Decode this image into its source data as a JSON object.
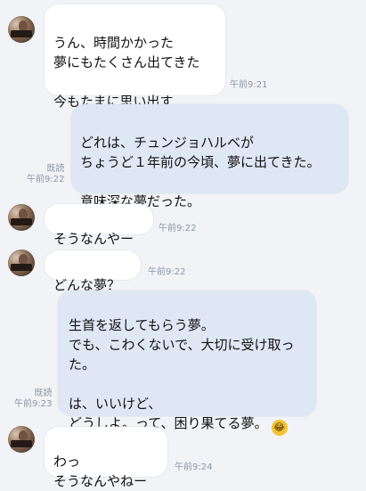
{
  "messages": [
    {
      "id": "m1",
      "direction": "incoming",
      "text": "うん、時間かかった\n夢にもたくさん出てきた\n\n今もたまに思い出す",
      "time": "午前9:21"
    },
    {
      "id": "m2",
      "direction": "outgoing",
      "text": "どれは、チュンジョハルベが\nちょうど１年前の今頃、夢に出てきた。\n\n意味深な夢だった。",
      "read": "既読",
      "time": "午前9:22"
    },
    {
      "id": "m3",
      "direction": "incoming",
      "text": "そうなんやー",
      "time": "午前9:22"
    },
    {
      "id": "m4",
      "direction": "incoming",
      "text": "どんな夢？",
      "time": "午前9:22"
    },
    {
      "id": "m5",
      "direction": "outgoing",
      "text": "生首を返してもらう夢。\nでも、こわくないで、大切に受け取った。\n\nは、いいけど、\nどうしよ。って、困り果てる夢。",
      "emoji": "crying-laughing-emoji",
      "read": "既読",
      "time": "午前9:23"
    },
    {
      "id": "m6",
      "direction": "incoming",
      "text": "わっ\nそうなんやねー",
      "time": "午前9:24"
    }
  ]
}
